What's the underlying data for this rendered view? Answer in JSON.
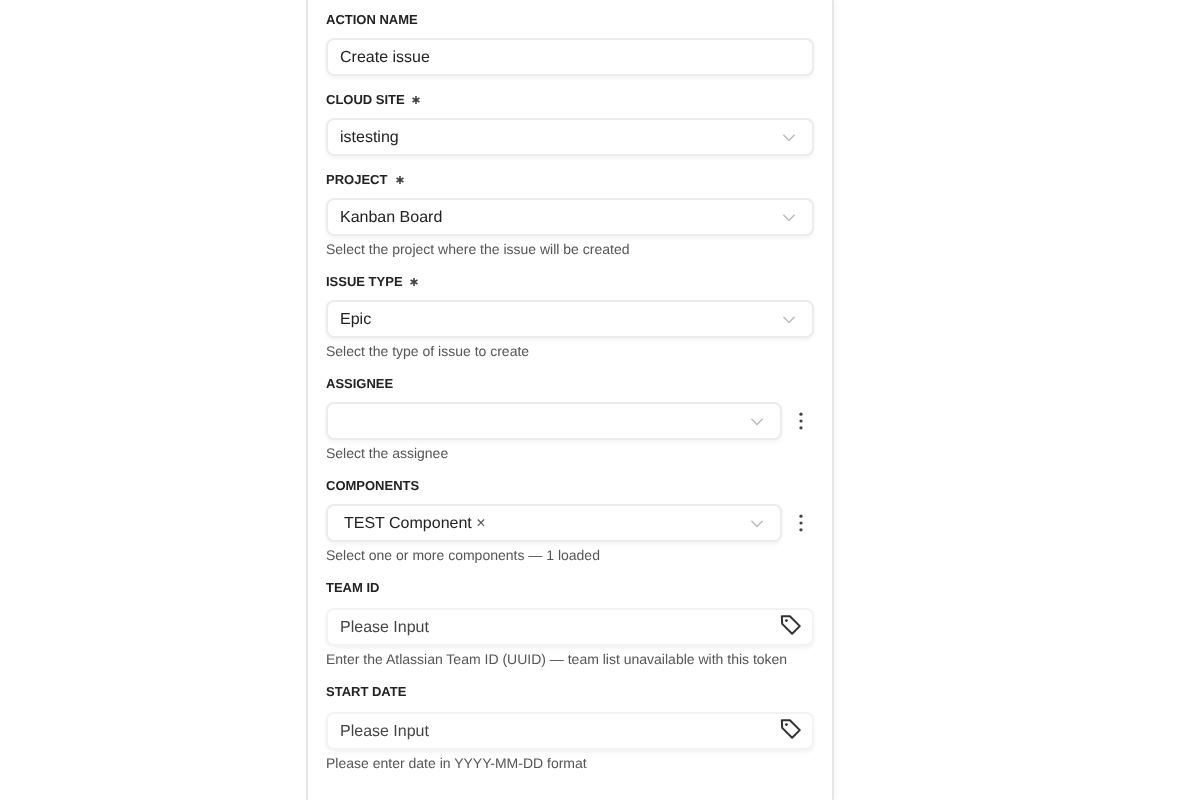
{
  "fields": [
    {
      "kind": "text",
      "label": "ACTION NAME",
      "required": false,
      "value": "Create issue"
    },
    {
      "kind": "select",
      "label": "CLOUD SITE",
      "required": true,
      "value": "istesting"
    },
    {
      "kind": "select",
      "label": "PROJECT",
      "required": true,
      "value": "Kanban Board",
      "hint": "Select the project where the issue will be created"
    },
    {
      "kind": "select",
      "label": "ISSUE TYPE",
      "required": true,
      "value": "Epic",
      "hint": "Select the type of issue to create"
    },
    {
      "kind": "select-menu",
      "label": "ASSIGNEE",
      "required": false,
      "hint": "Select the assignee"
    },
    {
      "kind": "select-menu",
      "label": "COMPONENTS",
      "required": false,
      "tags": [
        {
          "label": "TEST Component",
          "remove": "×"
        }
      ],
      "hint": "Select one or more components — 1 loaded"
    },
    {
      "kind": "tag-input",
      "label": "TEAM ID",
      "required": false,
      "placeholder": "Please Input",
      "hint": "Enter the Atlassian Team ID (UUID) — team list unavailable with this token"
    },
    {
      "kind": "tag-input",
      "label": "START DATE",
      "required": false,
      "placeholder": "Please Input",
      "hint": "Please enter date in YYYY-MM-DD format"
    }
  ]
}
